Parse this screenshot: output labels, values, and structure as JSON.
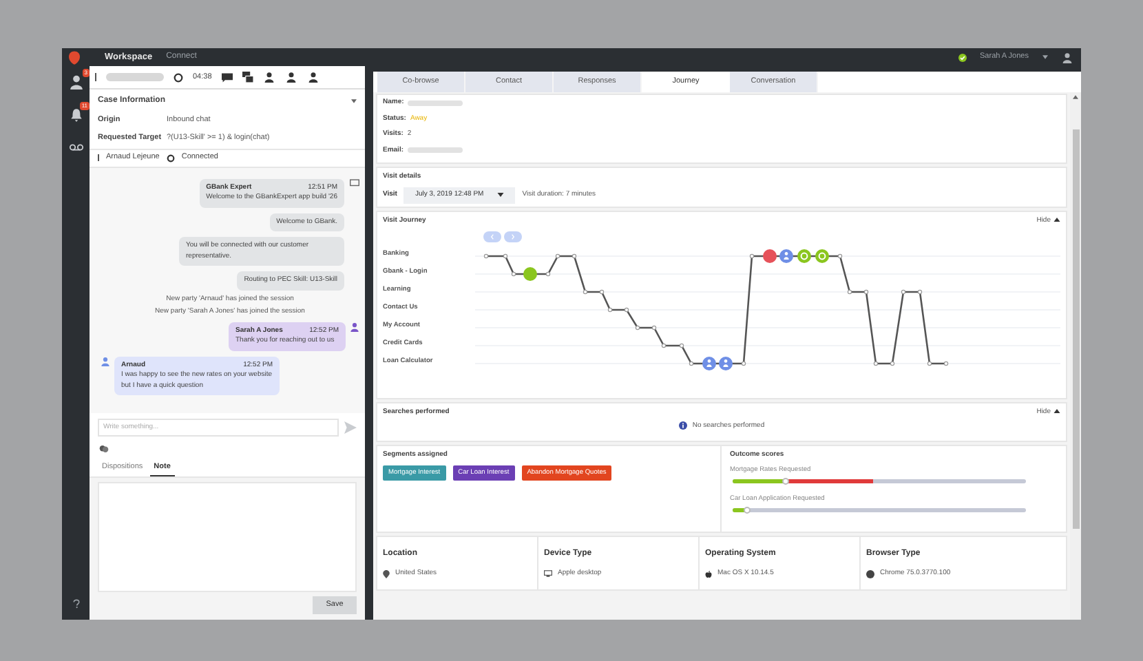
{
  "top_bar": {
    "title": "Workspace",
    "tab": "Connect",
    "user": "Sarah A Jones"
  },
  "nav": [
    {
      "kind": "contacts",
      "badge": "3"
    },
    {
      "kind": "bell",
      "badge": "11"
    },
    {
      "kind": "voicemail"
    }
  ],
  "toolbar": {
    "timer": "04:38"
  },
  "case_info": {
    "title": "Case Information",
    "fields": [
      {
        "label": "Origin",
        "value": "Inbound chat"
      },
      {
        "label": "Requested Target",
        "value": "?(U13-Skill' >= 1) & login(chat)"
      }
    ]
  },
  "participant": {
    "name": "Arnaud Lejeune",
    "status": "Connected"
  },
  "messages": [
    {
      "kind": "system",
      "sender": "GBank Expert",
      "time": "12:51 PM",
      "text": "Welcome to the GBankExpert app build '26"
    },
    {
      "kind": "system",
      "text": "Welcome to GBank."
    },
    {
      "kind": "system",
      "text": "You will be connected with our customer representative."
    },
    {
      "kind": "system",
      "text": "Routing to PEC Skill: U13-Skill"
    },
    {
      "kind": "notice",
      "text": "New party 'Arnaud' has joined the session"
    },
    {
      "kind": "notice",
      "text": "New party 'Sarah A Jones' has joined the session"
    },
    {
      "kind": "agent",
      "sender": "Sarah A Jones",
      "time": "12:52 PM",
      "text": "Thank you for reaching out to us"
    },
    {
      "kind": "customer",
      "sender": "Arnaud",
      "time": "12:52 PM",
      "text": "I was happy to see the new rates on your website but I have a quick question"
    }
  ],
  "composer": {
    "placeholder": "Write something..."
  },
  "bottom_tabs": [
    {
      "label": "Dispositions",
      "selected": false
    },
    {
      "label": "Note",
      "selected": true
    }
  ],
  "save_button": "Save",
  "tabs": [
    {
      "label": "Co-browse",
      "selected": false
    },
    {
      "label": "Contact",
      "selected": false
    },
    {
      "label": "Responses",
      "selected": false
    },
    {
      "label": "Journey",
      "selected": true
    },
    {
      "label": "Conversation",
      "selected": false
    }
  ],
  "customer": [
    {
      "label": "Name:"
    },
    {
      "label": "Status:",
      "value": "Away"
    },
    {
      "label": "Visits:",
      "value": "2"
    },
    {
      "label": "Email:"
    }
  ],
  "visit_details": {
    "title": "Visit details",
    "label": "Visit",
    "visit": "July 3, 2019 12:48 PM",
    "duration": "Visit duration: 7 minutes"
  },
  "visit_journey": {
    "title": "Visit Journey",
    "hide": "Hide",
    "pages": [
      "Banking",
      "Gbank - Login",
      "Learning",
      "Contact Us",
      "My Account",
      "Credit Cards",
      "Loan Calculator"
    ]
  },
  "searches": {
    "title": "Searches performed",
    "hide": "Hide",
    "message": "No searches performed"
  },
  "segments": {
    "title": "Segments assigned",
    "items": [
      {
        "label": "Mortgage Interest",
        "color": "#3a9aa6"
      },
      {
        "label": "Car Loan Interest",
        "color": "#6b3fb4"
      },
      {
        "label": "Abandon Mortgage Quotes",
        "color": "#e2451f"
      }
    ]
  },
  "outcomes": {
    "title": "Outcome scores",
    "items": [
      {
        "label": "Mortgage Rates Requested",
        "level": 0.18,
        "kind": "two-tone"
      },
      {
        "label": "Car Loan Application Requested",
        "level": 0.05,
        "kind": "plain"
      }
    ]
  },
  "details": [
    {
      "kind": "location",
      "title": "Location",
      "value": "United States"
    },
    {
      "kind": "device",
      "title": "Device Type",
      "value": "Apple desktop"
    },
    {
      "kind": "os",
      "title": "Operating System",
      "value": "Mac OS X 10.14.5"
    },
    {
      "kind": "browser",
      "title": "Browser Type",
      "value": "Chrome 75.0.3770.100"
    }
  ]
}
